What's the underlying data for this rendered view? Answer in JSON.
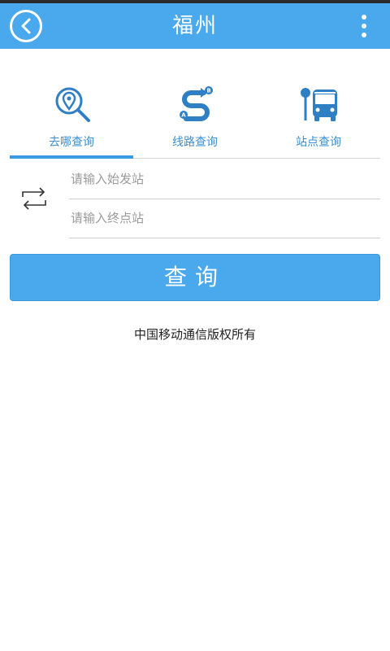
{
  "header": {
    "title": "福州",
    "back_icon": "back-icon",
    "more_icon": "more-icon"
  },
  "tabs": [
    {
      "label": "去哪查询",
      "icon": "location-search-icon",
      "selected": true
    },
    {
      "label": "线路查询",
      "icon": "route-icon",
      "selected": false
    },
    {
      "label": "站点查询",
      "icon": "bus-stop-icon",
      "selected": false
    }
  ],
  "form": {
    "start_placeholder": "请输入始发站",
    "end_placeholder": "请输入终点站",
    "swap_icon": "swap-icon"
  },
  "query_button": {
    "label": "查询"
  },
  "footer": {
    "copyright": "中国移动通信版权所有"
  },
  "colors": {
    "primary": "#4aa8ec",
    "icon_blue": "#2f7fc4",
    "label_blue": "#3a8fd0"
  }
}
